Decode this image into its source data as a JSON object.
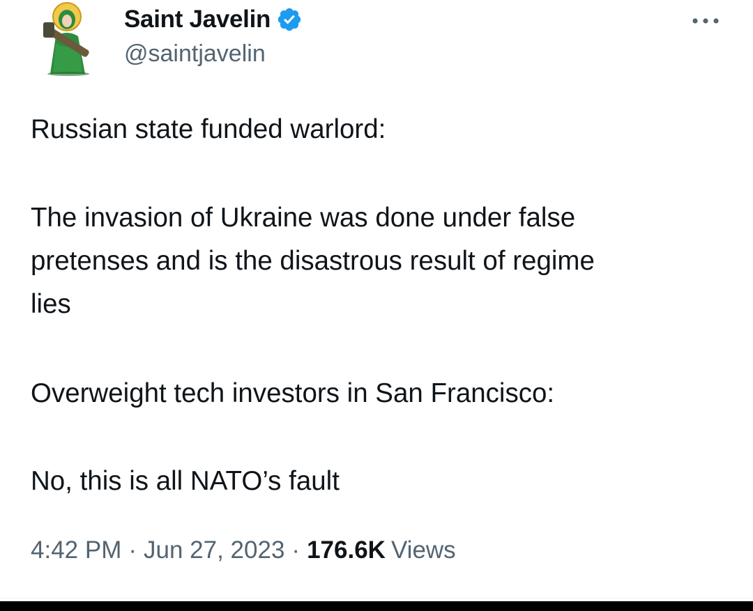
{
  "author": {
    "display_name": "Saint Javelin",
    "handle": "@saintjavelin",
    "verified": true,
    "avatar_icon": "saint-javelin-avatar"
  },
  "tweet": {
    "lines": [
      "Russian state funded warlord:",
      "The invasion of Ukraine was done under false",
      "pretenses and is the disastrous result of regime",
      "lies",
      "Overweight tech investors in San Francisco:",
      "No, this is all NATO’s fault"
    ]
  },
  "meta": {
    "time": "4:42 PM",
    "date": "Jun 27, 2023",
    "separator": "·",
    "views_count": "176.6K",
    "views_label": "Views"
  },
  "icons": {
    "verified": "verified-badge-icon",
    "more": "more-options-icon"
  },
  "colors": {
    "text_primary": "#0f1419",
    "text_secondary": "#536471",
    "verified_blue": "#1d9bf0",
    "avatar_green": "#2e8b3e"
  }
}
